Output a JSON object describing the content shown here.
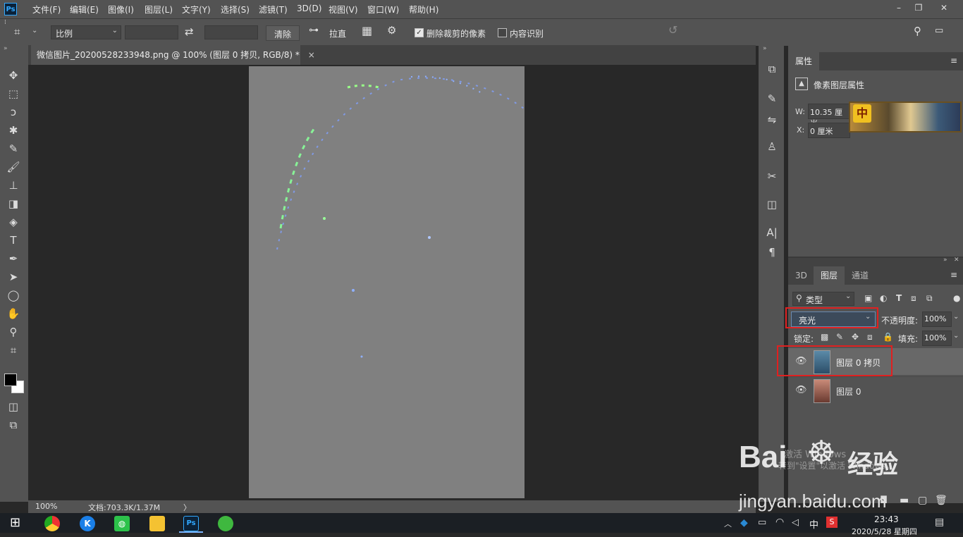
{
  "app": {
    "logo": "Ps"
  },
  "menu": [
    "文件(F)",
    "编辑(E)",
    "图像(I)",
    "图层(L)",
    "文字(Y)",
    "选择(S)",
    "滤镜(T)",
    "3D(D)",
    "视图(V)",
    "窗口(W)",
    "帮助(H)"
  ],
  "window_controls": {
    "minimize": "–",
    "restore": "❐",
    "close": "✕"
  },
  "options": {
    "ratio_select": "比例",
    "swap_icon": "⇄",
    "clear_button": "清除",
    "straighten_label": "拉直",
    "delete_cropped_label": "删除裁剪的像素",
    "delete_cropped_checked": true,
    "content_aware_label": "内容识别",
    "content_aware_checked": false
  },
  "tools": [
    {
      "name": "move-tool-icon",
      "glyph": "✥"
    },
    {
      "name": "marquee-tool-icon",
      "glyph": "⬚"
    },
    {
      "name": "lasso-tool-icon",
      "glyph": "ↄ"
    },
    {
      "name": "magic-wand-tool-icon",
      "glyph": "✱"
    },
    {
      "name": "eyedropper-tool-icon",
      "glyph": "✎"
    },
    {
      "name": "brush-tool-icon",
      "glyph": "🖌"
    },
    {
      "name": "stamp-tool-icon",
      "glyph": "⊥"
    },
    {
      "name": "eraser-tool-icon",
      "glyph": "◨"
    },
    {
      "name": "paint-bucket-tool-icon",
      "glyph": "◈"
    },
    {
      "name": "type-tool-icon",
      "glyph": "T"
    },
    {
      "name": "pen-tool-icon",
      "glyph": "✒"
    },
    {
      "name": "path-select-tool-icon",
      "glyph": "➤"
    },
    {
      "name": "ellipse-tool-icon",
      "glyph": "◯"
    },
    {
      "name": "hand-tool-icon",
      "glyph": "✋"
    },
    {
      "name": "zoom-tool-icon",
      "glyph": "⚲"
    },
    {
      "name": "crop-tool-icon",
      "glyph": "⌗"
    }
  ],
  "document": {
    "tab_title": "微信图片_20200528233948.png @ 100% (图层 0 拷贝, RGB/8) *",
    "tab_close": "×"
  },
  "status": {
    "zoom": "100%",
    "doc_size": "文档:703.3K/1.37M",
    "arrow": "〉"
  },
  "right_strip": [
    "⧉",
    "✎",
    "⇋",
    "♙",
    "✂",
    "◫",
    "A|",
    "¶"
  ],
  "properties": {
    "title": "属性",
    "subtitle": "像素图层属性",
    "w_label": "W:",
    "w_value": "10.35 厘米",
    "x_label": "X:",
    "x_value": "0 厘米"
  },
  "layers_panel": {
    "tabs": [
      "3D",
      "图层",
      "通道"
    ],
    "active_tab": 1,
    "filter_label": "类型",
    "blend_mode": "亮光",
    "opacity_label": "不透明度:",
    "opacity_value": "100%",
    "lock_label": "锁定:",
    "fill_label": "填充:",
    "fill_value": "100%",
    "layers": [
      {
        "name": "图层 0 拷贝",
        "selected": true
      },
      {
        "name": "图层 0",
        "selected": false
      }
    ]
  },
  "watermark": {
    "activate_line1": "激活 Windows",
    "activate_line2": "转到\"设置\"以激活 Windows。",
    "baidu_logo": "Bai",
    "baidu_suffix": "经验",
    "url": "jingyan.baidu.com"
  },
  "taskbar": {
    "time": "23:43",
    "date": "2020/5/28 星期四",
    "ime": "中",
    "lang": "S"
  },
  "colors": {
    "accent_red": "#e02020",
    "ps_blue": "#31a8ff",
    "panel_bg": "#535353"
  }
}
